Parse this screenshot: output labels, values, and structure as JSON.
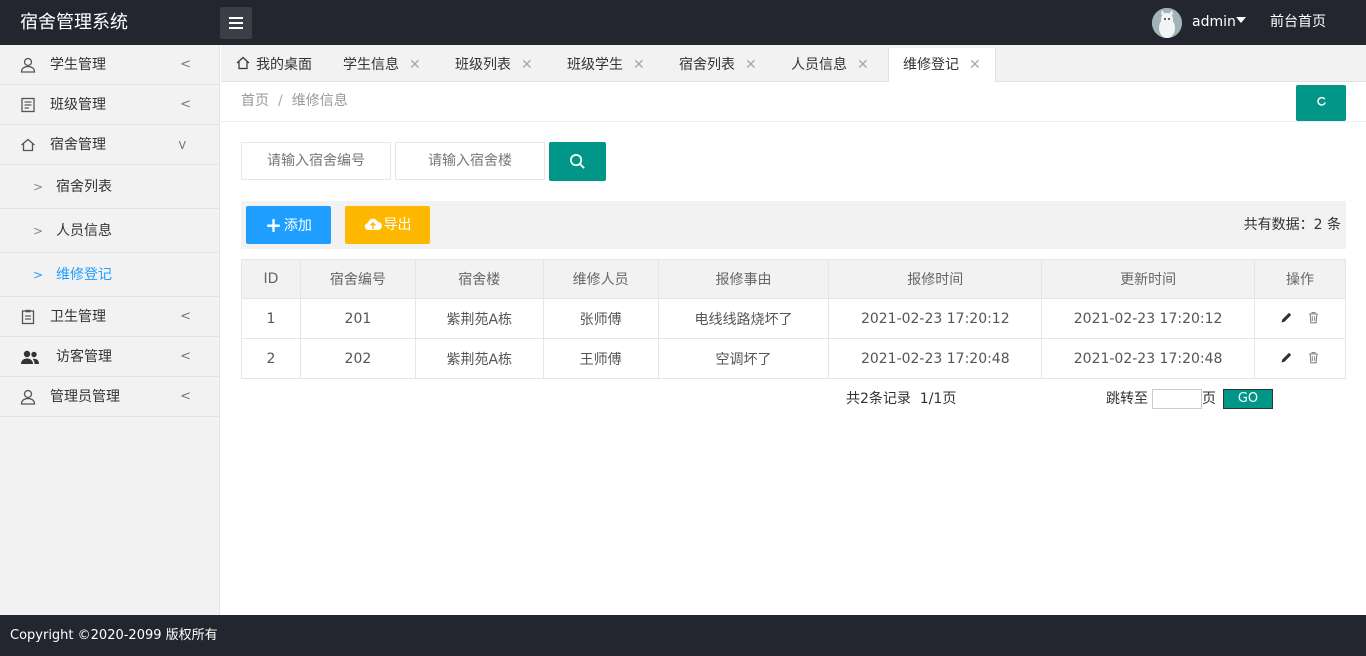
{
  "header": {
    "title": "宿舍管理系统",
    "user": "admin",
    "front_link": "前台首页"
  },
  "sidebar": {
    "items": [
      {
        "label": "学生管理",
        "icon": "user-icon"
      },
      {
        "label": "班级管理",
        "icon": "document-icon"
      },
      {
        "label": "宿舍管理",
        "icon": "home-icon",
        "expanded": true
      },
      {
        "label": "卫生管理",
        "icon": "clipboard-icon"
      },
      {
        "label": "访客管理",
        "icon": "users-icon"
      },
      {
        "label": "管理员管理",
        "icon": "user-icon"
      }
    ],
    "subitems": [
      {
        "label": "宿舍列表"
      },
      {
        "label": "人员信息"
      },
      {
        "label": "维修登记",
        "active": true
      }
    ]
  },
  "tabs": [
    {
      "label": "我的桌面"
    },
    {
      "label": "学生信息"
    },
    {
      "label": "班级列表"
    },
    {
      "label": "班级学生"
    },
    {
      "label": "宿舍列表"
    },
    {
      "label": "人员信息"
    },
    {
      "label": "维修登记",
      "active": true
    }
  ],
  "breadcrumb": {
    "home": "首页",
    "separator": "/",
    "current": "维修信息"
  },
  "search": {
    "dorm_no_placeholder": "请输入宿舍编号",
    "building_placeholder": "请输入宿舍楼"
  },
  "toolbar": {
    "add_label": "添加",
    "export_label": "导出",
    "total_text": "共有数据：2 条"
  },
  "table": {
    "columns": [
      "ID",
      "宿舍编号",
      "宿舍楼",
      "维修人员",
      "报修事由",
      "报修时间",
      "更新时间",
      "操作"
    ],
    "rows": [
      [
        "1",
        "201",
        "紫荆苑A栋",
        "张师傅",
        "电线线路烧坏了",
        "2021-02-23 17:20:12",
        "2021-02-23 17:20:12"
      ],
      [
        "2",
        "202",
        "紫荆苑A栋",
        "王师傅",
        "空调坏了",
        "2021-02-23 17:20:48",
        "2021-02-23 17:20:48"
      ]
    ]
  },
  "pager": {
    "info": "共2条记录  1/1页",
    "jump_label": "跳转至",
    "jump_unit": "页",
    "go_label": "GO"
  },
  "footer": {
    "copyright": "Copyright ©2020-2099 版权所有"
  },
  "colors": {
    "header_bg": "#23262e",
    "accent_green": "#009688",
    "accent_blue": "#1e9fff",
    "accent_orange": "#ffb800"
  }
}
